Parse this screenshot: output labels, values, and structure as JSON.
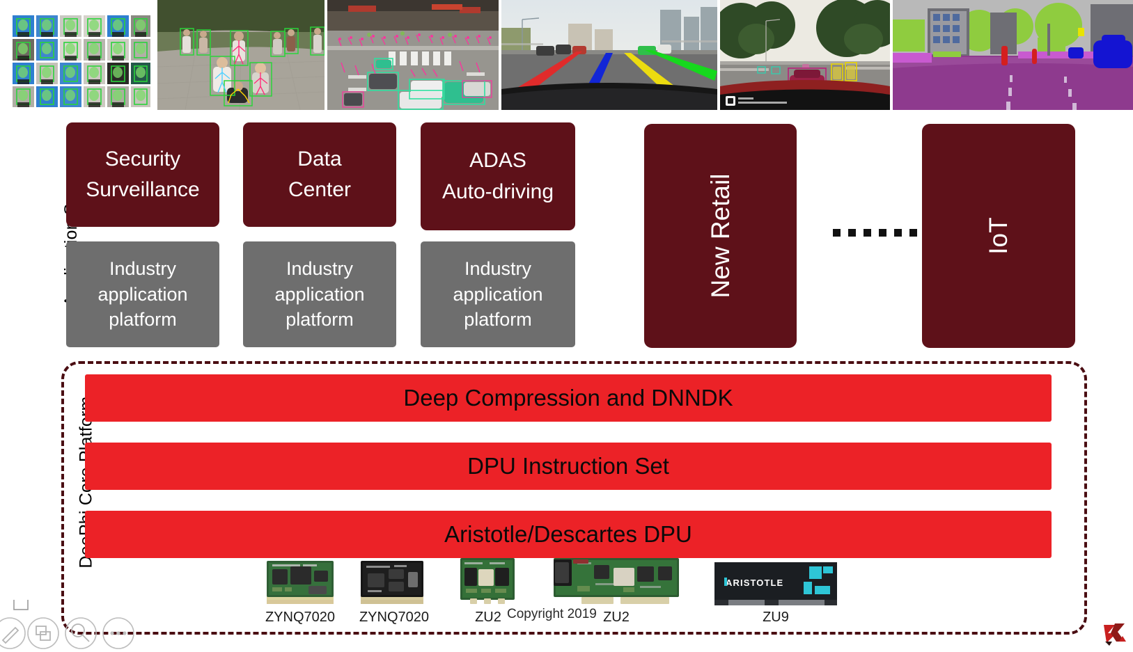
{
  "top_strip": {
    "images": [
      {
        "name": "face-detection-grid",
        "caption": "face detection grid"
      },
      {
        "name": "pose-estimation",
        "caption": "pedestrian pose estimation"
      },
      {
        "name": "traffic-intersection-detection",
        "caption": "traffic object detection"
      },
      {
        "name": "lane-detection",
        "caption": "lane line detection"
      },
      {
        "name": "dashcam-object-detection",
        "caption": "dashcam object detection"
      },
      {
        "name": "semantic-segmentation",
        "caption": "semantic segmentation"
      }
    ]
  },
  "sections": {
    "application_scene_label": "Application Scene",
    "core_platform_label": "DeePhi Core Platform"
  },
  "application_scene": {
    "columns": [
      {
        "title": "Security\nSurveillance",
        "title_lines": [
          "Security",
          "Surveillance"
        ],
        "platform_lines": [
          "Industry",
          "application",
          "platform"
        ]
      },
      {
        "title": "Data\nCenter",
        "title_lines": [
          "Data",
          "Center"
        ],
        "platform_lines": [
          "Industry",
          "application",
          "platform"
        ]
      },
      {
        "title": "ADAS\nAuto-driving",
        "title_lines": [
          "ADAS",
          "Auto-driving"
        ],
        "platform_lines": [
          "Industry",
          "application",
          "platform"
        ]
      }
    ],
    "tall_cards": [
      {
        "label": "New Retail"
      },
      {
        "label": "IoT"
      }
    ],
    "ellipsis_dots": 6
  },
  "core_platform": {
    "bars": [
      {
        "label": "Deep Compression and DNNDK"
      },
      {
        "label": "DPU Instruction Set"
      },
      {
        "label": "Aristotle/Descartes DPU"
      }
    ],
    "boards": [
      {
        "label": "ZYNQ7020",
        "kind": "green-som"
      },
      {
        "label": "ZYNQ7020",
        "kind": "black-som"
      },
      {
        "label": "ZU2",
        "kind": "green-som-small"
      },
      {
        "label": "ZU2",
        "kind": "green-pcie"
      },
      {
        "label": "ZU9",
        "kind": "aristotle-card",
        "silk": "ARISTOTLE"
      }
    ]
  },
  "footer": {
    "copyright": "Copyright 2019",
    "logo": "xilinx-logo"
  },
  "colors": {
    "maroon": "#5e1119",
    "gray": "#6e6e6e",
    "red": "#ec2227",
    "dash_border": "#4a0d12",
    "text_light": "#ffffff",
    "text_dark": "#0a0a0a"
  }
}
